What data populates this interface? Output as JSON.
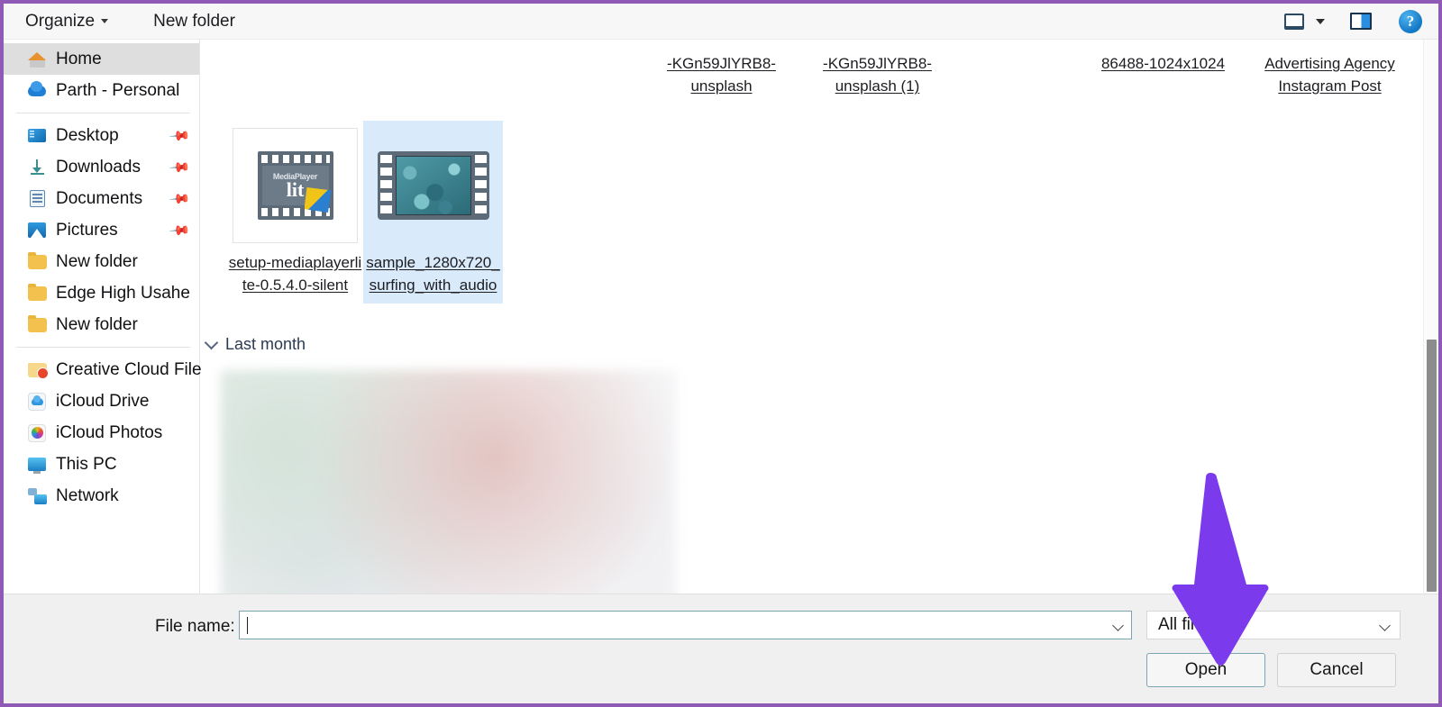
{
  "window": {
    "type": "file-open-dialog",
    "accent_border_color": "#8e5ab5",
    "selection_color": "#d9eafb",
    "annotation_color": "#7c3aed"
  },
  "toolbar": {
    "organize_label": "Organize",
    "new_folder_label": "New folder",
    "icons": {
      "layout_view": "layout-view-icon",
      "layout_dropdown": "chevron-down-icon",
      "preview_pane": "preview-pane-icon",
      "help": "help-icon",
      "help_glyph": "?"
    }
  },
  "sidebar": {
    "groups": [
      {
        "items": [
          {
            "label": "Home",
            "icon": "home-icon",
            "selected": true,
            "pinned": false
          },
          {
            "label": "Parth - Personal",
            "icon": "onedrive-cloud-icon",
            "selected": false,
            "pinned": false
          }
        ]
      },
      {
        "items": [
          {
            "label": "Desktop",
            "icon": "desktop-icon",
            "selected": false,
            "pinned": true
          },
          {
            "label": "Downloads",
            "icon": "downloads-icon",
            "selected": false,
            "pinned": true
          },
          {
            "label": "Documents",
            "icon": "documents-icon",
            "selected": false,
            "pinned": true
          },
          {
            "label": "Pictures",
            "icon": "pictures-icon",
            "selected": false,
            "pinned": true
          },
          {
            "label": "New folder",
            "icon": "folder-icon",
            "selected": false,
            "pinned": false
          },
          {
            "label": "Edge High Usahe",
            "icon": "folder-icon",
            "selected": false,
            "pinned": false
          },
          {
            "label": "New folder",
            "icon": "folder-icon",
            "selected": false,
            "pinned": false
          }
        ]
      },
      {
        "items": [
          {
            "label": "Creative Cloud Files",
            "icon": "creative-cloud-icon",
            "selected": false,
            "pinned": false
          },
          {
            "label": "iCloud Drive",
            "icon": "icloud-drive-icon",
            "selected": false,
            "pinned": false
          },
          {
            "label": "iCloud Photos",
            "icon": "icloud-photos-icon",
            "selected": false,
            "pinned": false
          },
          {
            "label": "This PC",
            "icon": "this-pc-icon",
            "selected": false,
            "pinned": false
          },
          {
            "label": "Network",
            "icon": "network-icon",
            "selected": false,
            "pinned": false
          }
        ]
      }
    ],
    "pin_glyph": "📌"
  },
  "content": {
    "scrolled_row_labels": [
      "-KGn59JlYRB8-unsplash",
      "-KGn59JlYRB8-unsplash (1)",
      "86488-1024x1024",
      "Advertising Agency Instagram Post"
    ],
    "files": [
      {
        "name": "setup-mediaplayerlite-0.5.4.0-silent",
        "thumbnail": "mediaplayerlite-installer-icon",
        "selected": false,
        "thumb_text_top": "MediaPlayer",
        "thumb_text_main": "lit"
      },
      {
        "name": "sample_1280x720_surfing_with_audio",
        "thumbnail": "video-filmstrip-thumbnail",
        "selected": true
      }
    ],
    "group_header": {
      "label": "Last month",
      "expanded": true,
      "chevron": "chevron-down-icon"
    },
    "blurred_region_note": ""
  },
  "bottom": {
    "filename_label": "File name:",
    "filename_value": "",
    "filename_placeholder": "",
    "filter_value": "All files",
    "open_label": "Open",
    "cancel_label": "Cancel"
  }
}
